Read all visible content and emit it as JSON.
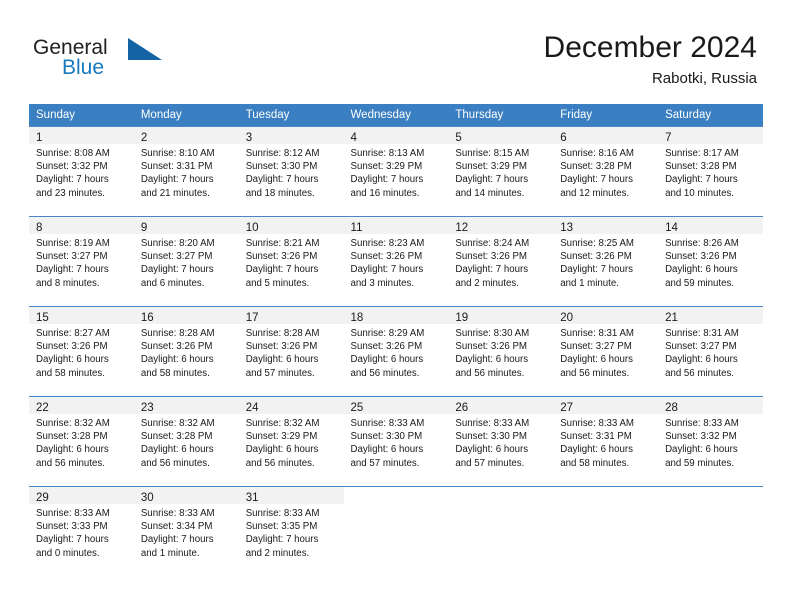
{
  "brand": {
    "name_part1": "General",
    "name_part2": "Blue",
    "logo_icon": "triangle-logo-icon",
    "accent_color": "#1878be"
  },
  "header": {
    "title": "December 2024",
    "location": "Rabotki, Russia"
  },
  "calendar": {
    "header_background": "#3a7fc1",
    "daynum_band_background": "#f2f2f2",
    "weekdays": [
      "Sunday",
      "Monday",
      "Tuesday",
      "Wednesday",
      "Thursday",
      "Friday",
      "Saturday"
    ],
    "weeks": [
      [
        {
          "day": "1",
          "sunrise": "Sunrise: 8:08 AM",
          "sunset": "Sunset: 3:32 PM",
          "daylight1": "Daylight: 7 hours",
          "daylight2": "and 23 minutes."
        },
        {
          "day": "2",
          "sunrise": "Sunrise: 8:10 AM",
          "sunset": "Sunset: 3:31 PM",
          "daylight1": "Daylight: 7 hours",
          "daylight2": "and 21 minutes."
        },
        {
          "day": "3",
          "sunrise": "Sunrise: 8:12 AM",
          "sunset": "Sunset: 3:30 PM",
          "daylight1": "Daylight: 7 hours",
          "daylight2": "and 18 minutes."
        },
        {
          "day": "4",
          "sunrise": "Sunrise: 8:13 AM",
          "sunset": "Sunset: 3:29 PM",
          "daylight1": "Daylight: 7 hours",
          "daylight2": "and 16 minutes."
        },
        {
          "day": "5",
          "sunrise": "Sunrise: 8:15 AM",
          "sunset": "Sunset: 3:29 PM",
          "daylight1": "Daylight: 7 hours",
          "daylight2": "and 14 minutes."
        },
        {
          "day": "6",
          "sunrise": "Sunrise: 8:16 AM",
          "sunset": "Sunset: 3:28 PM",
          "daylight1": "Daylight: 7 hours",
          "daylight2": "and 12 minutes."
        },
        {
          "day": "7",
          "sunrise": "Sunrise: 8:17 AM",
          "sunset": "Sunset: 3:28 PM",
          "daylight1": "Daylight: 7 hours",
          "daylight2": "and 10 minutes."
        }
      ],
      [
        {
          "day": "8",
          "sunrise": "Sunrise: 8:19 AM",
          "sunset": "Sunset: 3:27 PM",
          "daylight1": "Daylight: 7 hours",
          "daylight2": "and 8 minutes."
        },
        {
          "day": "9",
          "sunrise": "Sunrise: 8:20 AM",
          "sunset": "Sunset: 3:27 PM",
          "daylight1": "Daylight: 7 hours",
          "daylight2": "and 6 minutes."
        },
        {
          "day": "10",
          "sunrise": "Sunrise: 8:21 AM",
          "sunset": "Sunset: 3:26 PM",
          "daylight1": "Daylight: 7 hours",
          "daylight2": "and 5 minutes."
        },
        {
          "day": "11",
          "sunrise": "Sunrise: 8:23 AM",
          "sunset": "Sunset: 3:26 PM",
          "daylight1": "Daylight: 7 hours",
          "daylight2": "and 3 minutes."
        },
        {
          "day": "12",
          "sunrise": "Sunrise: 8:24 AM",
          "sunset": "Sunset: 3:26 PM",
          "daylight1": "Daylight: 7 hours",
          "daylight2": "and 2 minutes."
        },
        {
          "day": "13",
          "sunrise": "Sunrise: 8:25 AM",
          "sunset": "Sunset: 3:26 PM",
          "daylight1": "Daylight: 7 hours",
          "daylight2": "and 1 minute."
        },
        {
          "day": "14",
          "sunrise": "Sunrise: 8:26 AM",
          "sunset": "Sunset: 3:26 PM",
          "daylight1": "Daylight: 6 hours",
          "daylight2": "and 59 minutes."
        }
      ],
      [
        {
          "day": "15",
          "sunrise": "Sunrise: 8:27 AM",
          "sunset": "Sunset: 3:26 PM",
          "daylight1": "Daylight: 6 hours",
          "daylight2": "and 58 minutes."
        },
        {
          "day": "16",
          "sunrise": "Sunrise: 8:28 AM",
          "sunset": "Sunset: 3:26 PM",
          "daylight1": "Daylight: 6 hours",
          "daylight2": "and 58 minutes."
        },
        {
          "day": "17",
          "sunrise": "Sunrise: 8:28 AM",
          "sunset": "Sunset: 3:26 PM",
          "daylight1": "Daylight: 6 hours",
          "daylight2": "and 57 minutes."
        },
        {
          "day": "18",
          "sunrise": "Sunrise: 8:29 AM",
          "sunset": "Sunset: 3:26 PM",
          "daylight1": "Daylight: 6 hours",
          "daylight2": "and 56 minutes."
        },
        {
          "day": "19",
          "sunrise": "Sunrise: 8:30 AM",
          "sunset": "Sunset: 3:26 PM",
          "daylight1": "Daylight: 6 hours",
          "daylight2": "and 56 minutes."
        },
        {
          "day": "20",
          "sunrise": "Sunrise: 8:31 AM",
          "sunset": "Sunset: 3:27 PM",
          "daylight1": "Daylight: 6 hours",
          "daylight2": "and 56 minutes."
        },
        {
          "day": "21",
          "sunrise": "Sunrise: 8:31 AM",
          "sunset": "Sunset: 3:27 PM",
          "daylight1": "Daylight: 6 hours",
          "daylight2": "and 56 minutes."
        }
      ],
      [
        {
          "day": "22",
          "sunrise": "Sunrise: 8:32 AM",
          "sunset": "Sunset: 3:28 PM",
          "daylight1": "Daylight: 6 hours",
          "daylight2": "and 56 minutes."
        },
        {
          "day": "23",
          "sunrise": "Sunrise: 8:32 AM",
          "sunset": "Sunset: 3:28 PM",
          "daylight1": "Daylight: 6 hours",
          "daylight2": "and 56 minutes."
        },
        {
          "day": "24",
          "sunrise": "Sunrise: 8:32 AM",
          "sunset": "Sunset: 3:29 PM",
          "daylight1": "Daylight: 6 hours",
          "daylight2": "and 56 minutes."
        },
        {
          "day": "25",
          "sunrise": "Sunrise: 8:33 AM",
          "sunset": "Sunset: 3:30 PM",
          "daylight1": "Daylight: 6 hours",
          "daylight2": "and 57 minutes."
        },
        {
          "day": "26",
          "sunrise": "Sunrise: 8:33 AM",
          "sunset": "Sunset: 3:30 PM",
          "daylight1": "Daylight: 6 hours",
          "daylight2": "and 57 minutes."
        },
        {
          "day": "27",
          "sunrise": "Sunrise: 8:33 AM",
          "sunset": "Sunset: 3:31 PM",
          "daylight1": "Daylight: 6 hours",
          "daylight2": "and 58 minutes."
        },
        {
          "day": "28",
          "sunrise": "Sunrise: 8:33 AM",
          "sunset": "Sunset: 3:32 PM",
          "daylight1": "Daylight: 6 hours",
          "daylight2": "and 59 minutes."
        }
      ],
      [
        {
          "day": "29",
          "sunrise": "Sunrise: 8:33 AM",
          "sunset": "Sunset: 3:33 PM",
          "daylight1": "Daylight: 7 hours",
          "daylight2": "and 0 minutes."
        },
        {
          "day": "30",
          "sunrise": "Sunrise: 8:33 AM",
          "sunset": "Sunset: 3:34 PM",
          "daylight1": "Daylight: 7 hours",
          "daylight2": "and 1 minute."
        },
        {
          "day": "31",
          "sunrise": "Sunrise: 8:33 AM",
          "sunset": "Sunset: 3:35 PM",
          "daylight1": "Daylight: 7 hours",
          "daylight2": "and 2 minutes."
        },
        null,
        null,
        null,
        null
      ]
    ]
  }
}
